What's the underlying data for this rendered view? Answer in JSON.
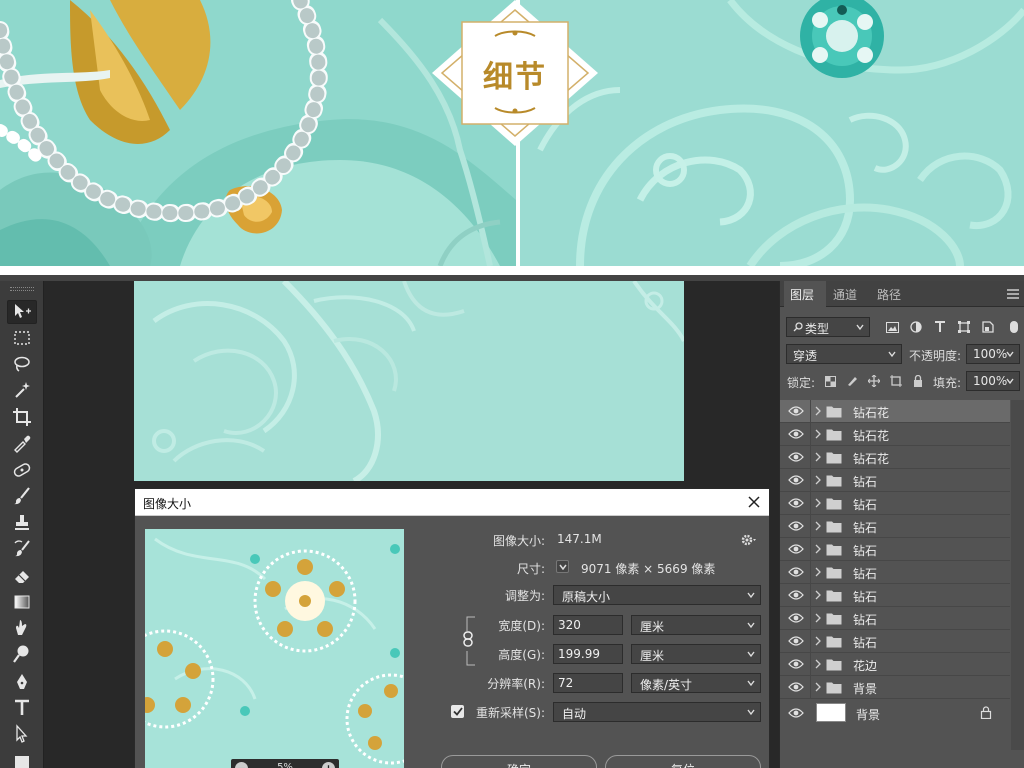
{
  "banner": {
    "badge_text": "细节"
  },
  "toolbox": {
    "tools": [
      {
        "name": "move-tool",
        "icon": "move-icon",
        "active": true
      },
      {
        "name": "marquee-tool",
        "icon": "marquee-icon"
      },
      {
        "name": "lasso-tool",
        "icon": "lasso-icon"
      },
      {
        "name": "magic-wand-tool",
        "icon": "magic-wand-icon"
      },
      {
        "name": "crop-tool",
        "icon": "crop-icon"
      },
      {
        "name": "eyedropper-tool",
        "icon": "eyedropper-icon"
      },
      {
        "name": "healing-tool",
        "icon": "healing-icon"
      },
      {
        "name": "brush-tool",
        "icon": "brush-icon"
      },
      {
        "name": "stamp-tool",
        "icon": "stamp-icon"
      },
      {
        "name": "history-brush-tool",
        "icon": "history-brush-icon"
      },
      {
        "name": "eraser-tool",
        "icon": "eraser-icon"
      },
      {
        "name": "gradient-tool",
        "icon": "gradient-icon"
      },
      {
        "name": "smudge-tool",
        "icon": "smudge-icon"
      },
      {
        "name": "dodge-tool",
        "icon": "dodge-icon"
      },
      {
        "name": "pen-tool",
        "icon": "pen-icon"
      },
      {
        "name": "type-tool",
        "icon": "type-icon"
      },
      {
        "name": "path-select-tool",
        "icon": "path-select-icon"
      },
      {
        "name": "shape-tool",
        "icon": "rectangle-icon"
      }
    ]
  },
  "dialog": {
    "title": "图像大小",
    "image_size_label": "图像大小:",
    "image_size_value": "147.1M",
    "dimensions_label": "尺寸:",
    "dimensions_value": "9071 像素 × 5669 像素",
    "fit_to_label": "调整为:",
    "fit_to_value": "原稿大小",
    "width_label": "宽度(D):",
    "width_value": "320",
    "width_unit": "厘米",
    "height_label": "高度(G):",
    "height_value": "199.99",
    "height_unit": "厘米",
    "resolution_label": "分辨率(R):",
    "resolution_value": "72",
    "resolution_unit": "像素/英寸",
    "resample_label": "重新采样(S):",
    "resample_value": "自动",
    "resample_checked": true,
    "zoom_value": "5%",
    "ok_label": "确定",
    "reset_label": "复位"
  },
  "panel": {
    "tabs": [
      "图层",
      "通道",
      "路径"
    ],
    "active_tab": "图层",
    "filter_label": "类型",
    "blend_mode": "穿透",
    "opacity_label": "不透明度:",
    "opacity_value": "100%",
    "lock_label": "锁定:",
    "fill_label": "填充:",
    "fill_value": "100%",
    "layers": [
      {
        "name": "钻石花",
        "selected": true
      },
      {
        "name": "钻石花"
      },
      {
        "name": "钻石花"
      },
      {
        "name": "钻石"
      },
      {
        "name": "钻石"
      },
      {
        "name": "钻石"
      },
      {
        "name": "钻石"
      },
      {
        "name": "钻石"
      },
      {
        "name": "钻石"
      },
      {
        "name": "钻石"
      },
      {
        "name": "钻石"
      },
      {
        "name": "花边"
      },
      {
        "name": "背景"
      }
    ],
    "background_layer": {
      "name": "背景"
    }
  },
  "colors": {
    "teal_light": "#a6e0d6",
    "panel_bg": "#535353",
    "app_bg": "#282828",
    "gold": "#b88a2a"
  }
}
